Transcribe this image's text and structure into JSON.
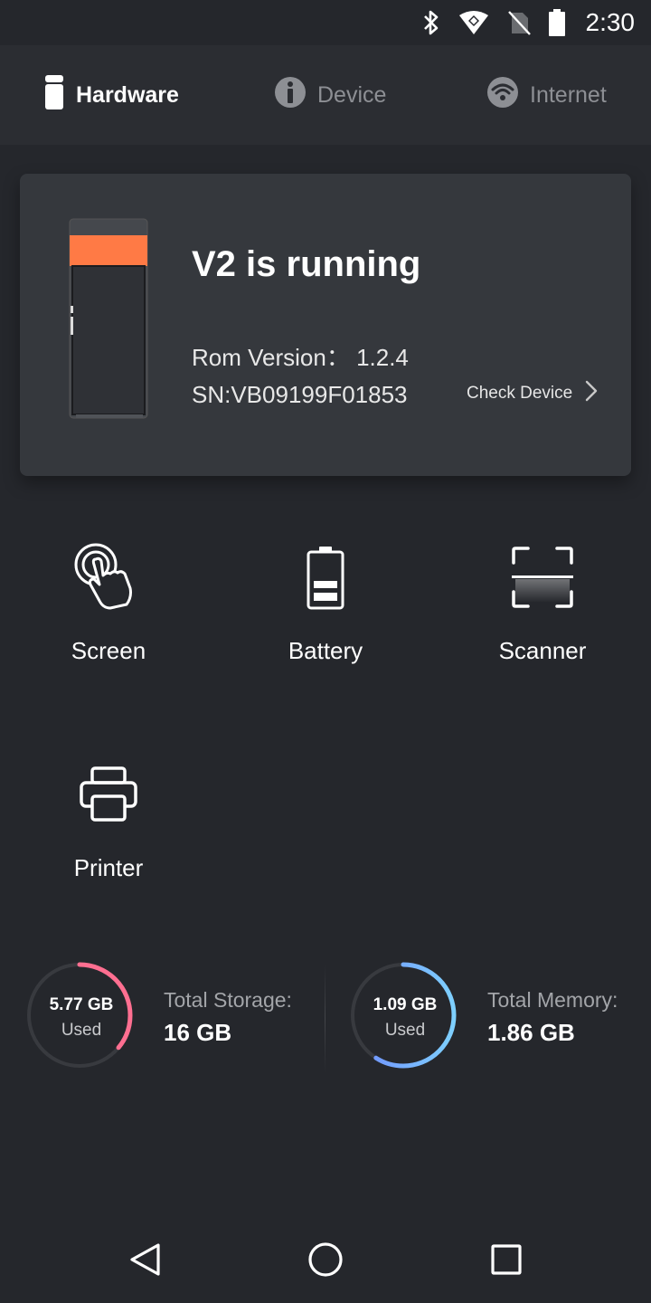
{
  "status_bar": {
    "time": "2:30",
    "icons": [
      "bluetooth-icon",
      "wifi-icon",
      "no-sim-icon",
      "battery-icon"
    ]
  },
  "tabs": [
    {
      "label": "Hardware",
      "icon": "device-icon",
      "active": true
    },
    {
      "label": "Device",
      "icon": "info-icon",
      "active": false
    },
    {
      "label": "Internet",
      "icon": "wifi-icon",
      "active": false
    }
  ],
  "device_card": {
    "title": "V2 is running",
    "rom_version": "Rom Version：  1.2.4",
    "serial": "SN:VB09199F01853",
    "check_label": "Check Device",
    "accent_color": "#ff7a45"
  },
  "features": [
    {
      "label": "Screen",
      "icon": "touch-icon"
    },
    {
      "label": "Battery",
      "icon": "battery-icon"
    },
    {
      "label": "Scanner",
      "icon": "scanner-icon"
    },
    {
      "label": "Printer",
      "icon": "printer-icon"
    }
  ],
  "storage": {
    "used": "5.77 GB",
    "used_label": "Used",
    "total_label": "Total Storage:",
    "total": "16 GB",
    "used_fraction": 0.36,
    "color": "#ff6f91"
  },
  "memory": {
    "used": "1.09 GB",
    "used_label": "Used",
    "total_label": "Total Memory:",
    "total": "1.86 GB",
    "used_fraction": 0.59,
    "color": "#6fa8ff"
  },
  "nav": [
    "back-icon",
    "home-icon",
    "recents-icon"
  ]
}
